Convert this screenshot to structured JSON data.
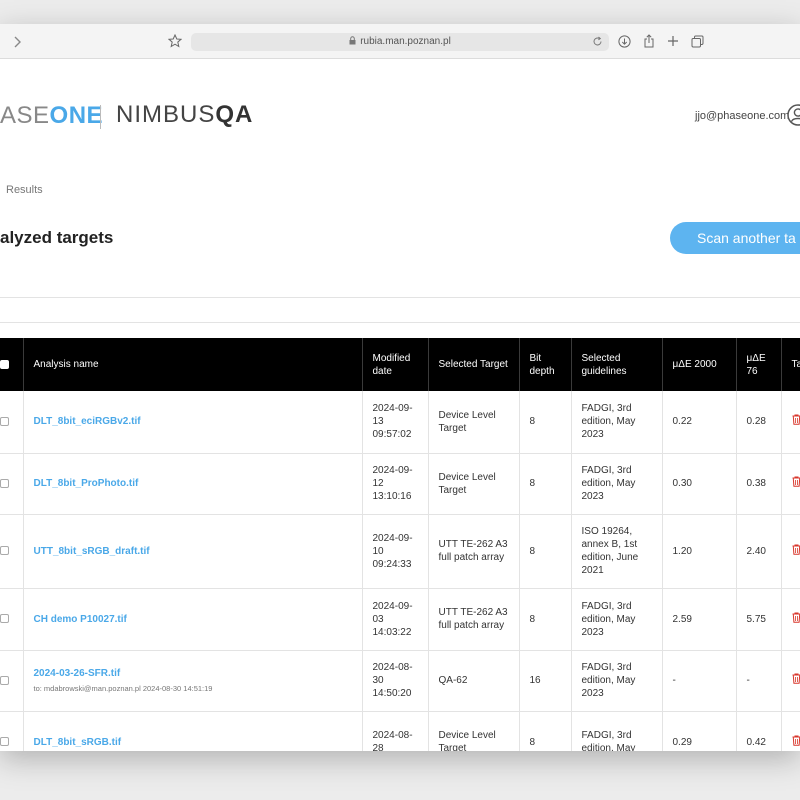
{
  "browser": {
    "url": "rubia.man.poznan.pl"
  },
  "brand": {
    "phaseone_visible": "ASE",
    "phaseone_bold": "ON",
    "phaseone_last": "E",
    "nimbus": "NIMBUS",
    "nimbus_qa": "QA"
  },
  "user": {
    "email": "jjo@phaseone.com"
  },
  "breadcrumb": "Results",
  "page": {
    "title": "alyzed targets",
    "scan_button": "Scan another ta"
  },
  "table": {
    "headers": {
      "name": "Analysis name",
      "modified": "Modified date",
      "target": "Selected Target",
      "bit": "Bit depth",
      "guidelines": "Selected guidelines",
      "de2000": "μΔE 2000",
      "de76": "μΔE 76",
      "ta": "Ta"
    },
    "rows": [
      {
        "name": "DLT_8bit_eciRGBv2.tif",
        "sub": "",
        "date": "2024-09-13 09:57:02",
        "target": "Device Level Target",
        "bit": "8",
        "guidelines": "FADGI, 3rd edition, May 2023",
        "de2000": "0.22",
        "de76": "0.28"
      },
      {
        "name": "DLT_8bit_ProPhoto.tif",
        "sub": "",
        "date": "2024-09-12 13:10:16",
        "target": "Device Level Target",
        "bit": "8",
        "guidelines": "FADGI, 3rd edition, May 2023",
        "de2000": "0.30",
        "de76": "0.38"
      },
      {
        "name": "UTT_8bit_sRGB_draft.tif",
        "sub": "",
        "date": "2024-09-10 09:24:33",
        "target": "UTT TE-262 A3 full patch array",
        "bit": "8",
        "guidelines": "ISO 19264, annex B, 1st edition, June 2021",
        "de2000": "1.20",
        "de76": "2.40"
      },
      {
        "name": "CH demo P10027.tif",
        "sub": "",
        "date": "2024-09-03 14:03:22",
        "target": "UTT TE-262 A3 full patch array",
        "bit": "8",
        "guidelines": "FADGI, 3rd edition, May 2023",
        "de2000": "2.59",
        "de76": "5.75"
      },
      {
        "name": "2024-03-26-SFR.tif",
        "sub": "to: mdabrowski@man.poznan.pl 2024-08-30 14:51:19",
        "date": "2024-08-30 14:50:20",
        "target": "QA-62",
        "bit": "16",
        "guidelines": "FADGI, 3rd edition, May 2023",
        "de2000": "-",
        "de76": "-"
      },
      {
        "name": "DLT_8bit_sRGB.tif",
        "sub": "",
        "date": "2024-08-28",
        "target": "Device Level Target",
        "bit": "8",
        "guidelines": "FADGI, 3rd edition, May",
        "de2000": "0.29",
        "de76": "0.42"
      }
    ]
  },
  "colors": {
    "accent": "#4aa8e8",
    "button": "#5db4f0",
    "header_bg": "#000000",
    "trash": "#d9362b"
  }
}
